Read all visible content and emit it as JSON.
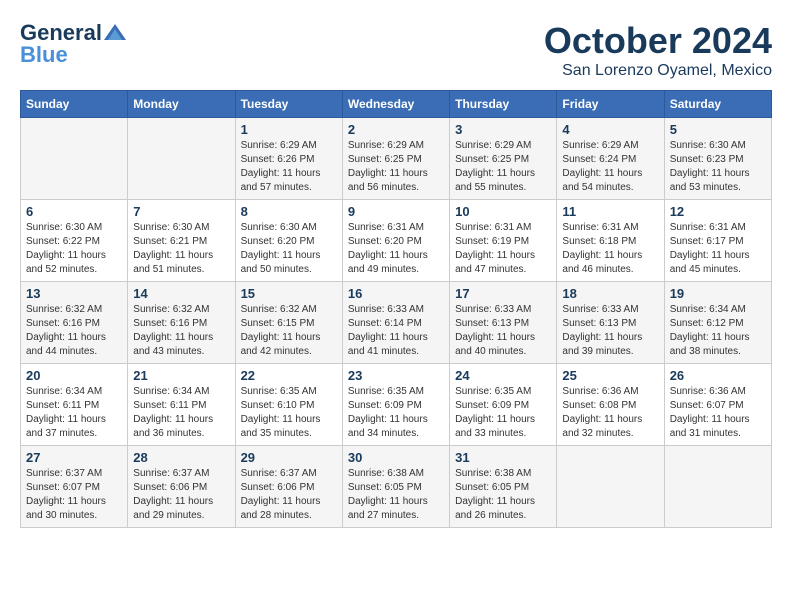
{
  "header": {
    "logo_general": "General",
    "logo_blue": "Blue",
    "month_title": "October 2024",
    "location": "San Lorenzo Oyamel, Mexico"
  },
  "days_of_week": [
    "Sunday",
    "Monday",
    "Tuesday",
    "Wednesday",
    "Thursday",
    "Friday",
    "Saturday"
  ],
  "weeks": [
    [
      {
        "day": "",
        "info": ""
      },
      {
        "day": "",
        "info": ""
      },
      {
        "day": "1",
        "info": "Sunrise: 6:29 AM\nSunset: 6:26 PM\nDaylight: 11 hours\nand 57 minutes."
      },
      {
        "day": "2",
        "info": "Sunrise: 6:29 AM\nSunset: 6:25 PM\nDaylight: 11 hours\nand 56 minutes."
      },
      {
        "day": "3",
        "info": "Sunrise: 6:29 AM\nSunset: 6:25 PM\nDaylight: 11 hours\nand 55 minutes."
      },
      {
        "day": "4",
        "info": "Sunrise: 6:29 AM\nSunset: 6:24 PM\nDaylight: 11 hours\nand 54 minutes."
      },
      {
        "day": "5",
        "info": "Sunrise: 6:30 AM\nSunset: 6:23 PM\nDaylight: 11 hours\nand 53 minutes."
      }
    ],
    [
      {
        "day": "6",
        "info": "Sunrise: 6:30 AM\nSunset: 6:22 PM\nDaylight: 11 hours\nand 52 minutes."
      },
      {
        "day": "7",
        "info": "Sunrise: 6:30 AM\nSunset: 6:21 PM\nDaylight: 11 hours\nand 51 minutes."
      },
      {
        "day": "8",
        "info": "Sunrise: 6:30 AM\nSunset: 6:20 PM\nDaylight: 11 hours\nand 50 minutes."
      },
      {
        "day": "9",
        "info": "Sunrise: 6:31 AM\nSunset: 6:20 PM\nDaylight: 11 hours\nand 49 minutes."
      },
      {
        "day": "10",
        "info": "Sunrise: 6:31 AM\nSunset: 6:19 PM\nDaylight: 11 hours\nand 47 minutes."
      },
      {
        "day": "11",
        "info": "Sunrise: 6:31 AM\nSunset: 6:18 PM\nDaylight: 11 hours\nand 46 minutes."
      },
      {
        "day": "12",
        "info": "Sunrise: 6:31 AM\nSunset: 6:17 PM\nDaylight: 11 hours\nand 45 minutes."
      }
    ],
    [
      {
        "day": "13",
        "info": "Sunrise: 6:32 AM\nSunset: 6:16 PM\nDaylight: 11 hours\nand 44 minutes."
      },
      {
        "day": "14",
        "info": "Sunrise: 6:32 AM\nSunset: 6:16 PM\nDaylight: 11 hours\nand 43 minutes."
      },
      {
        "day": "15",
        "info": "Sunrise: 6:32 AM\nSunset: 6:15 PM\nDaylight: 11 hours\nand 42 minutes."
      },
      {
        "day": "16",
        "info": "Sunrise: 6:33 AM\nSunset: 6:14 PM\nDaylight: 11 hours\nand 41 minutes."
      },
      {
        "day": "17",
        "info": "Sunrise: 6:33 AM\nSunset: 6:13 PM\nDaylight: 11 hours\nand 40 minutes."
      },
      {
        "day": "18",
        "info": "Sunrise: 6:33 AM\nSunset: 6:13 PM\nDaylight: 11 hours\nand 39 minutes."
      },
      {
        "day": "19",
        "info": "Sunrise: 6:34 AM\nSunset: 6:12 PM\nDaylight: 11 hours\nand 38 minutes."
      }
    ],
    [
      {
        "day": "20",
        "info": "Sunrise: 6:34 AM\nSunset: 6:11 PM\nDaylight: 11 hours\nand 37 minutes."
      },
      {
        "day": "21",
        "info": "Sunrise: 6:34 AM\nSunset: 6:11 PM\nDaylight: 11 hours\nand 36 minutes."
      },
      {
        "day": "22",
        "info": "Sunrise: 6:35 AM\nSunset: 6:10 PM\nDaylight: 11 hours\nand 35 minutes."
      },
      {
        "day": "23",
        "info": "Sunrise: 6:35 AM\nSunset: 6:09 PM\nDaylight: 11 hours\nand 34 minutes."
      },
      {
        "day": "24",
        "info": "Sunrise: 6:35 AM\nSunset: 6:09 PM\nDaylight: 11 hours\nand 33 minutes."
      },
      {
        "day": "25",
        "info": "Sunrise: 6:36 AM\nSunset: 6:08 PM\nDaylight: 11 hours\nand 32 minutes."
      },
      {
        "day": "26",
        "info": "Sunrise: 6:36 AM\nSunset: 6:07 PM\nDaylight: 11 hours\nand 31 minutes."
      }
    ],
    [
      {
        "day": "27",
        "info": "Sunrise: 6:37 AM\nSunset: 6:07 PM\nDaylight: 11 hours\nand 30 minutes."
      },
      {
        "day": "28",
        "info": "Sunrise: 6:37 AM\nSunset: 6:06 PM\nDaylight: 11 hours\nand 29 minutes."
      },
      {
        "day": "29",
        "info": "Sunrise: 6:37 AM\nSunset: 6:06 PM\nDaylight: 11 hours\nand 28 minutes."
      },
      {
        "day": "30",
        "info": "Sunrise: 6:38 AM\nSunset: 6:05 PM\nDaylight: 11 hours\nand 27 minutes."
      },
      {
        "day": "31",
        "info": "Sunrise: 6:38 AM\nSunset: 6:05 PM\nDaylight: 11 hours\nand 26 minutes."
      },
      {
        "day": "",
        "info": ""
      },
      {
        "day": "",
        "info": ""
      }
    ]
  ]
}
